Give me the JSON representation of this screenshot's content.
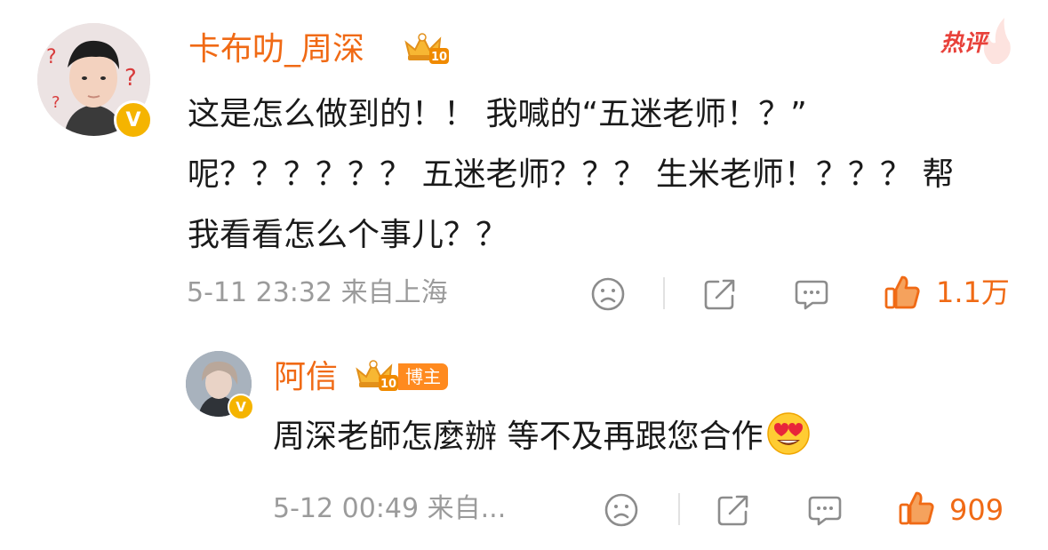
{
  "comment": {
    "username": "卡布叻_周深",
    "level_badge": "10",
    "hot_tag": "热评",
    "lines": [
      "这是怎么做到的！！ 我喊的“五迷老师！？”",
      "呢？？？？？？ 五迷老师？？？ 生米老师！？？？ 帮",
      "我看看怎么个事儿？？"
    ],
    "time": "5-11 23:32",
    "location": "来自上海",
    "likes": "1.1万",
    "icons": [
      "sad-face-icon",
      "share-icon",
      "comment-icon",
      "thumbs-up-icon"
    ]
  },
  "reply": {
    "username": "阿信",
    "level_badge": "10",
    "role_tag": "博主",
    "text": "周深老師怎麼辦  等不及再跟您合作",
    "emoji": "heart-eyes-emoji",
    "time": "5-12 00:49",
    "location": "来自...",
    "likes": "909",
    "icons": [
      "sad-face-icon",
      "share-icon",
      "comment-icon",
      "thumbs-up-icon"
    ]
  },
  "colors": {
    "accent": "#f06a15",
    "hot": "#e8413a",
    "meta": "#9b9b9b",
    "text": "#1a1a1a",
    "verified": "#f5b400"
  }
}
